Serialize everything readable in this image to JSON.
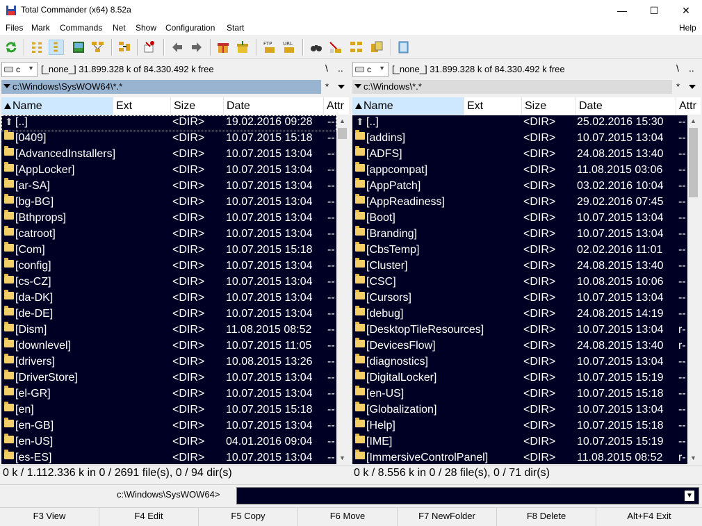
{
  "window": {
    "title": "Total Commander (x64) 8.52a",
    "min": "—",
    "max": "☐",
    "close": "✕"
  },
  "menu": {
    "items": [
      "Files",
      "Mark",
      "Commands",
      "Net",
      "Show",
      "Configuration",
      "Start"
    ],
    "help": "Help"
  },
  "left": {
    "drive": "c",
    "drive_info": "[_none_]  31.899.328 k of 84.330.492 k free",
    "nav_root": "\\",
    "nav_up": "..",
    "path": "c:\\Windows\\SysWOW64\\*.*",
    "filter_star": "*",
    "headers": {
      "name": "Name",
      "ext": "Ext",
      "size": "Size",
      "date": "Date",
      "attr": "Attr"
    },
    "rows": [
      {
        "name": "[..]",
        "size": "<DIR>",
        "date": "19.02.2016 09:28",
        "attr": "--",
        "up": true
      },
      {
        "name": "[0409]",
        "size": "<DIR>",
        "date": "10.07.2015 15:18",
        "attr": "--"
      },
      {
        "name": "[AdvancedInstallers]",
        "size": "<DIR>",
        "date": "10.07.2015 13:04",
        "attr": "--"
      },
      {
        "name": "[AppLocker]",
        "size": "<DIR>",
        "date": "10.07.2015 13:04",
        "attr": "--"
      },
      {
        "name": "[ar-SA]",
        "size": "<DIR>",
        "date": "10.07.2015 13:04",
        "attr": "--"
      },
      {
        "name": "[bg-BG]",
        "size": "<DIR>",
        "date": "10.07.2015 13:04",
        "attr": "--"
      },
      {
        "name": "[Bthprops]",
        "size": "<DIR>",
        "date": "10.07.2015 13:04",
        "attr": "--"
      },
      {
        "name": "[catroot]",
        "size": "<DIR>",
        "date": "10.07.2015 13:04",
        "attr": "--"
      },
      {
        "name": "[Com]",
        "size": "<DIR>",
        "date": "10.07.2015 15:18",
        "attr": "--"
      },
      {
        "name": "[config]",
        "size": "<DIR>",
        "date": "10.07.2015 13:04",
        "attr": "--"
      },
      {
        "name": "[cs-CZ]",
        "size": "<DIR>",
        "date": "10.07.2015 13:04",
        "attr": "--"
      },
      {
        "name": "[da-DK]",
        "size": "<DIR>",
        "date": "10.07.2015 13:04",
        "attr": "--"
      },
      {
        "name": "[de-DE]",
        "size": "<DIR>",
        "date": "10.07.2015 13:04",
        "attr": "--"
      },
      {
        "name": "[Dism]",
        "size": "<DIR>",
        "date": "11.08.2015 08:52",
        "attr": "--"
      },
      {
        "name": "[downlevel]",
        "size": "<DIR>",
        "date": "10.07.2015 11:05",
        "attr": "--"
      },
      {
        "name": "[drivers]",
        "size": "<DIR>",
        "date": "10.08.2015 13:26",
        "attr": "--"
      },
      {
        "name": "[DriverStore]",
        "size": "<DIR>",
        "date": "10.07.2015 13:04",
        "attr": "--"
      },
      {
        "name": "[el-GR]",
        "size": "<DIR>",
        "date": "10.07.2015 13:04",
        "attr": "--"
      },
      {
        "name": "[en]",
        "size": "<DIR>",
        "date": "10.07.2015 15:18",
        "attr": "--"
      },
      {
        "name": "[en-GB]",
        "size": "<DIR>",
        "date": "10.07.2015 13:04",
        "attr": "--"
      },
      {
        "name": "[en-US]",
        "size": "<DIR>",
        "date": "04.01.2016 09:04",
        "attr": "--"
      },
      {
        "name": "[es-ES]",
        "size": "<DIR>",
        "date": "10.07.2015 13:04",
        "attr": "--"
      }
    ],
    "status": "0 k / 1.112.336 k in 0 / 2691 file(s), 0 / 94 dir(s)"
  },
  "right": {
    "drive": "c",
    "drive_info": "[_none_]  31.899.328 k of 84.330.492 k free",
    "nav_root": "\\",
    "nav_up": "..",
    "path": "c:\\Windows\\*.*",
    "filter_star": "*",
    "headers": {
      "name": "Name",
      "ext": "Ext",
      "size": "Size",
      "date": "Date",
      "attr": "Attr"
    },
    "rows": [
      {
        "name": "[..]",
        "size": "<DIR>",
        "date": "25.02.2016 15:30",
        "attr": "--",
        "up": true
      },
      {
        "name": "[addins]",
        "size": "<DIR>",
        "date": "10.07.2015 13:04",
        "attr": "--"
      },
      {
        "name": "[ADFS]",
        "size": "<DIR>",
        "date": "24.08.2015 13:40",
        "attr": "--"
      },
      {
        "name": "[appcompat]",
        "size": "<DIR>",
        "date": "11.08.2015 03:06",
        "attr": "--"
      },
      {
        "name": "[AppPatch]",
        "size": "<DIR>",
        "date": "03.02.2016 10:04",
        "attr": "--"
      },
      {
        "name": "[AppReadiness]",
        "size": "<DIR>",
        "date": "29.02.2016 07:45",
        "attr": "--"
      },
      {
        "name": "[Boot]",
        "size": "<DIR>",
        "date": "10.07.2015 13:04",
        "attr": "--"
      },
      {
        "name": "[Branding]",
        "size": "<DIR>",
        "date": "10.07.2015 13:04",
        "attr": "--"
      },
      {
        "name": "[CbsTemp]",
        "size": "<DIR>",
        "date": "02.02.2016 11:01",
        "attr": "--"
      },
      {
        "name": "[Cluster]",
        "size": "<DIR>",
        "date": "24.08.2015 13:40",
        "attr": "--"
      },
      {
        "name": "[CSC]",
        "size": "<DIR>",
        "date": "10.08.2015 10:06",
        "attr": "--"
      },
      {
        "name": "[Cursors]",
        "size": "<DIR>",
        "date": "10.07.2015 13:04",
        "attr": "--"
      },
      {
        "name": "[debug]",
        "size": "<DIR>",
        "date": "24.08.2015 14:19",
        "attr": "--"
      },
      {
        "name": "[DesktopTileResources]",
        "size": "<DIR>",
        "date": "10.07.2015 13:04",
        "attr": "r-"
      },
      {
        "name": "[DevicesFlow]",
        "size": "<DIR>",
        "date": "24.08.2015 13:40",
        "attr": "r-"
      },
      {
        "name": "[diagnostics]",
        "size": "<DIR>",
        "date": "10.07.2015 13:04",
        "attr": "--"
      },
      {
        "name": "[DigitalLocker]",
        "size": "<DIR>",
        "date": "10.07.2015 15:19",
        "attr": "--"
      },
      {
        "name": "[en-US]",
        "size": "<DIR>",
        "date": "10.07.2015 15:18",
        "attr": "--"
      },
      {
        "name": "[Globalization]",
        "size": "<DIR>",
        "date": "10.07.2015 13:04",
        "attr": "--"
      },
      {
        "name": "[Help]",
        "size": "<DIR>",
        "date": "10.07.2015 15:18",
        "attr": "--"
      },
      {
        "name": "[IME]",
        "size": "<DIR>",
        "date": "10.07.2015 15:19",
        "attr": "--"
      },
      {
        "name": "[ImmersiveControlPanel]",
        "size": "<DIR>",
        "date": "11.08.2015 08:52",
        "attr": "r-"
      }
    ],
    "status": "0 k / 8.556 k in 0 / 28 file(s), 0 / 71 dir(s)"
  },
  "command": {
    "path_label": "c:\\Windows\\SysWOW64>",
    "value": ""
  },
  "fkeys": [
    "F3 View",
    "F4 Edit",
    "F5 Copy",
    "F6 Move",
    "F7 NewFolder",
    "F8 Delete",
    "Alt+F4 Exit"
  ],
  "toolbar": [
    "refresh-icon",
    "brief-view-icon",
    "full-view-icon",
    "thumbnail-view-icon",
    "tree-view-icon",
    "compare-dirs-icon",
    "sync-dirs-icon",
    "back-icon",
    "forward-icon",
    "pack-icon",
    "unpack-icon",
    "ftp-icon",
    "url-icon",
    "find-icon",
    "multi-rename-icon",
    "dir-hotlist-icon",
    "notepad-icon",
    "help-book-icon"
  ],
  "colors": {
    "panel_bg": "#000024",
    "path_active": "#99b4d1",
    "sort_header": "#cde8ff"
  }
}
